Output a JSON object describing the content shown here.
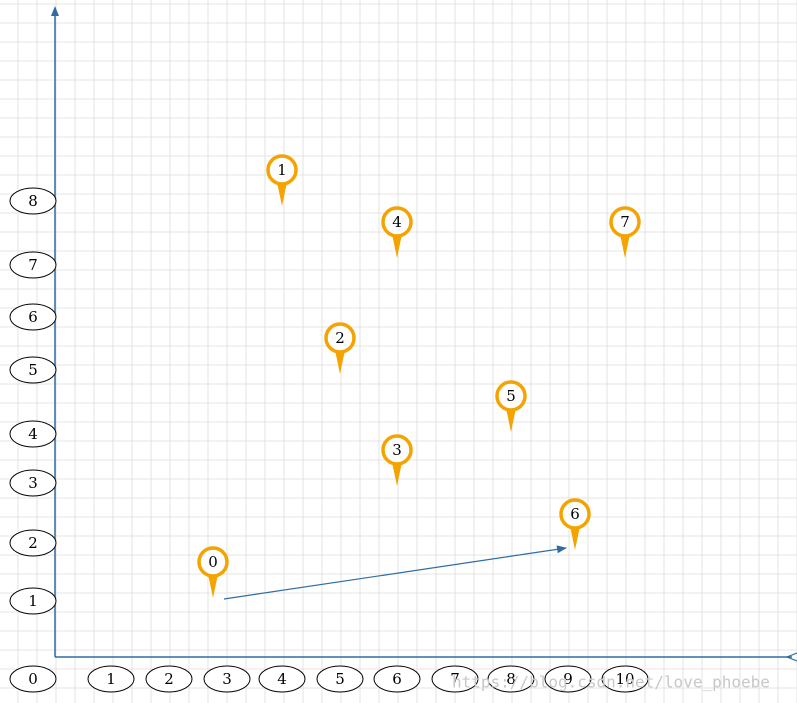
{
  "colors": {
    "grid": "#dcdcdc",
    "axis": "#2e6da4",
    "marker": "#f5a300",
    "oval_stroke": "#000000"
  },
  "x_axis_labels": [
    "0",
    "1",
    "2",
    "3",
    "4",
    "5",
    "6",
    "7",
    "8",
    "9",
    "10"
  ],
  "y_axis_labels": [
    "1",
    "2",
    "3",
    "4",
    "5",
    "6",
    "7",
    "8"
  ],
  "markers": [
    {
      "label": "0",
      "x": 3,
      "y": 1
    },
    {
      "label": "1",
      "x": 4,
      "y": 8
    },
    {
      "label": "2",
      "x": 5,
      "y": 5.5
    },
    {
      "label": "3",
      "x": 6,
      "y": 3.5
    },
    {
      "label": "4",
      "x": 6,
      "y": 7.1
    },
    {
      "label": "5",
      "x": 8,
      "y": 4.4
    },
    {
      "label": "6",
      "x": 9,
      "y": 2.1
    },
    {
      "label": "7",
      "x": 10,
      "y": 7.1
    }
  ],
  "arrow": {
    "from": {
      "x": 3,
      "y": 1
    },
    "to": {
      "x": 9,
      "y": 2
    }
  },
  "watermark": "https://blog.csdn.net/love_phoebe"
}
